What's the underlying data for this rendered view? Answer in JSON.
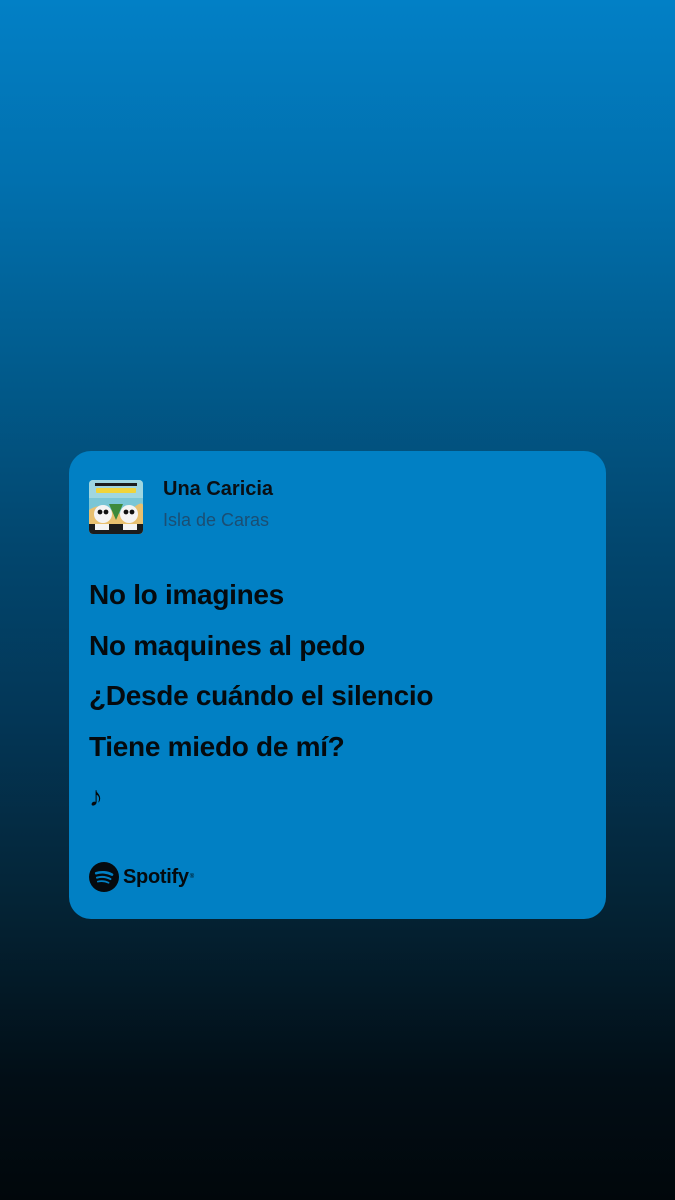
{
  "track": {
    "title": "Una Caricia",
    "artist": "Isla de Caras"
  },
  "lyrics": [
    "No lo imagines",
    "No maquines al pedo",
    "¿Desde cuándo el silencio",
    "Tiene miedo de mí?",
    "♪"
  ],
  "branding": {
    "name": "Spotify",
    "logo_icon": "spotify-logo-icon"
  },
  "colors": {
    "card_background": "#0180c4",
    "title_text": "#0a0f14",
    "artist_text": "#1b4e73",
    "background_top": "#0280c6",
    "background_bottom": "#01070b"
  }
}
